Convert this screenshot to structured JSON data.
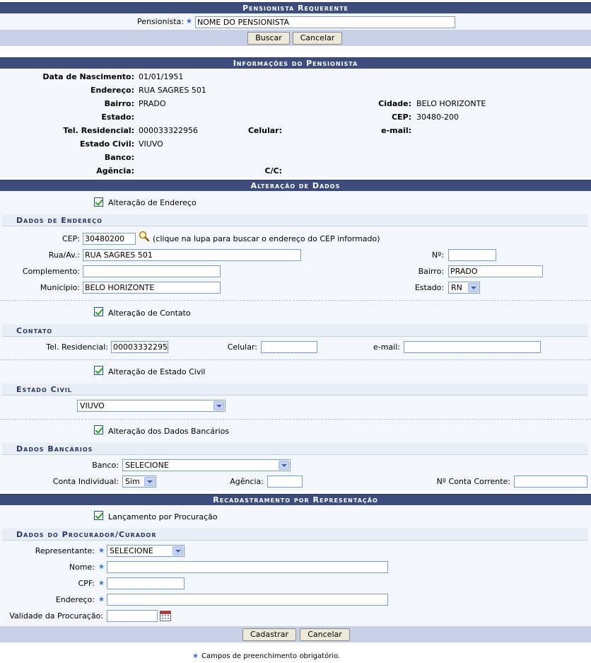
{
  "requerente": {
    "title": "Pensionista Requerente",
    "pensionista_label": "Pensionista:",
    "pensionista_value": "NOME DO PENSIONISTA",
    "buscar": "Buscar",
    "cancelar": "Cancelar"
  },
  "info": {
    "title": "Informações do Pensionista",
    "nascimento_label": "Data de Nascimento:",
    "nascimento": "01/01/1951",
    "endereco_label": "Endereço:",
    "endereco": "RUA SAGRES 501",
    "bairro_label": "Bairro:",
    "bairro": "PRADO",
    "cidade_label": "Cidade:",
    "cidade": "BELO HORIZONTE",
    "estado_label": "Estado:",
    "cep_label": "CEP:",
    "cep": "30480-200",
    "tel_label": "Tel. Residencial:",
    "tel": "000033322956",
    "celular_label": "Celular:",
    "email_label": "e-mail:",
    "civil_label": "Estado Civil:",
    "civil": "VIUVO",
    "banco_label": "Banco:",
    "agencia_label": "Agência:",
    "cc_label": "C/C:"
  },
  "alteracao": {
    "title": "Alteração de Dados",
    "endereco_check": "Alteração de Endereço",
    "endereco_section": "Dados de Endereço",
    "cep_label": "CEP:",
    "cep": "30480200",
    "cep_hint": "(clique na lupa para buscar o endereço do CEP informado)",
    "rua_label": "Rua/Av.:",
    "rua": "RUA SAGRES 501",
    "numero_label": "Nº:",
    "complemento_label": "Complemento:",
    "bairro_label": "Bairro:",
    "bairro": "PRADO",
    "municipio_label": "Município:",
    "municipio": "BELO HORIZONTE",
    "estado_label": "Estado:",
    "estado": "RN",
    "contato_check": "Alteração de Contato",
    "contato_section": "Contato",
    "tel_label": "Tel. Residencial:",
    "tel": "00003332295",
    "celular_label": "Celular:",
    "email_label": "e-mail:",
    "civil_check": "Alteração de Estado Civil",
    "civil_section": "Estado Civil",
    "civil": "VIUVO",
    "banco_check": "Alteração dos Dados Bancários",
    "banco_section": "Dados Bancários",
    "banco_label": "Banco:",
    "banco": "SELECIONE",
    "conta_ind_label": "Conta Individual:",
    "conta_ind": "Sim",
    "agencia_label": "Agência:",
    "conta_corrente_label": "Nº Conta Corrente:"
  },
  "representacao": {
    "title": "Recadastramento por Representação",
    "procuracao_check": "Lançamento por Procuração",
    "section": "Dados do Procurador/Curador",
    "representante_label": "Representante:",
    "representante": "SELECIONE",
    "nome_label": "Nome:",
    "cpf_label": "CPF:",
    "endereco_label": "Endereço:",
    "validade_label": "Validade da Procuração:",
    "cadastrar": "Cadastrar",
    "cancelar": "Cancelar"
  },
  "footer": {
    "obrigatorio": "Campos de preenchimento obrigatório."
  },
  "colors": {
    "header_bg": "#3c4c7c",
    "panel_bg": "#f3f6fa",
    "button_bar": "#c7d0e6",
    "required_star": "#3a6fd8"
  }
}
